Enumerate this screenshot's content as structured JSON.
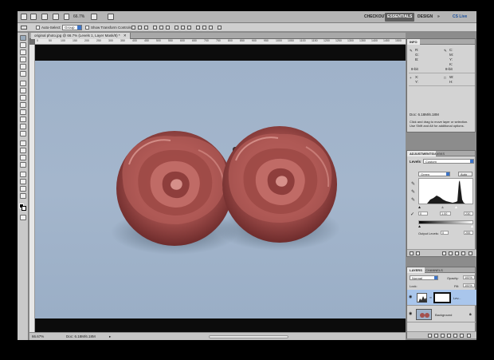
{
  "appbar": {
    "zoom": "66.7%",
    "workspaces": [
      "CHECKOUT",
      "ESSENTIALS",
      "DESIGN"
    ],
    "more": "»",
    "cslive": "CS Live"
  },
  "options": {
    "auto_select_label": "Auto-Select:",
    "auto_select_value": "Group",
    "show_transform_label": "Show Transform Controls"
  },
  "document": {
    "tab_title": "original photo.jpg @ 66.7% (Levels 1, Layer Mask/8) *",
    "ruler_ticks": [
      "0",
      "50",
      "100",
      "150",
      "200",
      "250",
      "300",
      "350",
      "400",
      "450",
      "500",
      "550",
      "600",
      "650",
      "700",
      "750",
      "800",
      "850",
      "900",
      "950",
      "1000",
      "1050",
      "1100",
      "1150",
      "1200",
      "1250",
      "1300",
      "1350",
      "1400",
      "1450",
      "1500"
    ],
    "status_zoom": "66.67%",
    "status_doc": "Doc: 6.18M/6.18M"
  },
  "info_panel": {
    "tab": "INFO",
    "rgb": [
      "R:",
      "G:",
      "B:"
    ],
    "cmyk": [
      "C:",
      "M:",
      "Y:",
      "K:"
    ],
    "bits": [
      "8-bit",
      "8-bit"
    ],
    "xy": [
      "X:",
      "Y:"
    ],
    "wh": [
      "W:",
      "H:"
    ],
    "doc": "Doc: 6.18M/6.18M",
    "hint": "Click and drag to move layer or selection. Use Shift and Alt for additional options."
  },
  "adjustments_panel": {
    "tabs": [
      "ADJUSTMENTS",
      "MASKS"
    ],
    "title": "Levels",
    "preset": "Custom",
    "channel": "Green",
    "auto": "Auto",
    "input": [
      "0",
      "1.00",
      "230"
    ],
    "output_label": "Output Levels:",
    "output": [
      "0",
      "255"
    ]
  },
  "layers_panel": {
    "tabs": [
      "LAYERS",
      "CHANNELS"
    ],
    "blend_mode": "Normal",
    "opacity_label": "Opacity:",
    "opacity": "100%",
    "fill_label": "Fill:",
    "fill": "100%",
    "lock_label": "Lock:",
    "layers": [
      {
        "name": "Lev..."
      },
      {
        "name": "Background"
      }
    ]
  }
}
